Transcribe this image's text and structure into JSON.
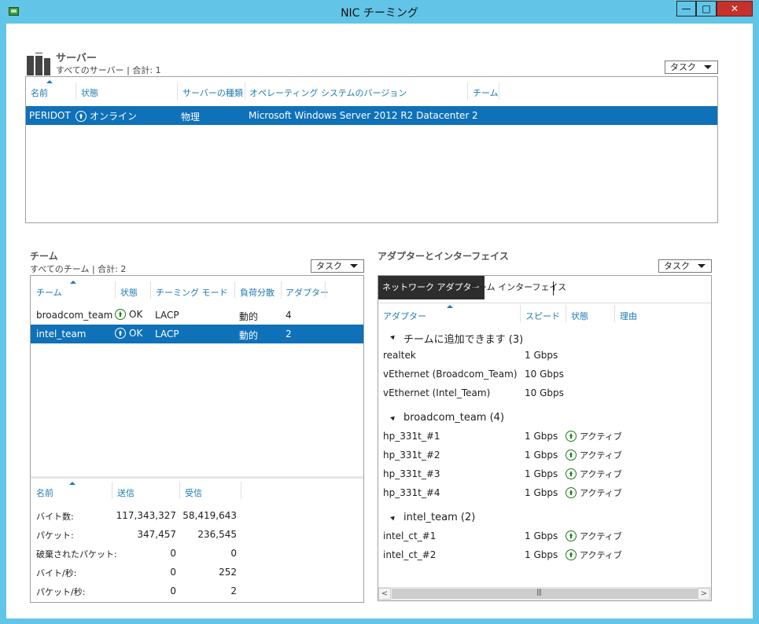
{
  "window": {
    "title": "NIC チーミング",
    "minimize_label": "—",
    "maximize_label": "□",
    "close_label": "✕"
  },
  "servers": {
    "title": "サーバー",
    "subtitle": "すべてのサーバー | 合計: 1",
    "task_label": "タスク",
    "columns": [
      "名前",
      "状態",
      "サーバーの種類",
      "オペレーティング システムのバージョン",
      "チーム"
    ],
    "rows": [
      {
        "name": "PERIDOT",
        "status": "オンライン",
        "type": "物理",
        "os": "Microsoft Windows Server 2012 R2 Datacenter",
        "teams": "2"
      }
    ]
  },
  "teams": {
    "title": "チーム",
    "subtitle": "すべてのチーム | 合計: 2",
    "task_label": "タスク",
    "columns": [
      "チーム",
      "状態",
      "チーミング モード",
      "負荷分散",
      "アダプター"
    ],
    "rows": [
      {
        "team": "broadcom_team",
        "status": "OK",
        "mode": "LACP",
        "lb": "動的",
        "adapters": "4"
      },
      {
        "team": "intel_team",
        "status": "OK",
        "mode": "LACP",
        "lb": "動的",
        "adapters": "2"
      }
    ],
    "stats_columns": [
      "名前",
      "送信",
      "受信"
    ],
    "stats": [
      {
        "name": "バイト数:",
        "sent": "117,343,327",
        "recv": "58,419,643"
      },
      {
        "name": "パケット:",
        "sent": "347,457",
        "recv": "236,545"
      },
      {
        "name": "破棄されたパケット:",
        "sent": "0",
        "recv": "0"
      },
      {
        "name": "バイト/秒:",
        "sent": "0",
        "recv": "252"
      },
      {
        "name": "パケット/秒:",
        "sent": "0",
        "recv": "2"
      }
    ]
  },
  "adapters": {
    "title": "アダプターとインターフェイス",
    "task_label": "タスク",
    "tabs": [
      "ネットワーク アダプター",
      "チーム インターフェイス"
    ],
    "columns": [
      "アダプター",
      "スピード",
      "状態",
      "理由"
    ],
    "groups": [
      {
        "header": "チームに追加できます (3)",
        "items": [
          {
            "name": "realtek",
            "speed": "1 Gbps",
            "status": ""
          },
          {
            "name": "vEthernet (Broadcom_Team)",
            "speed": "10 Gbps",
            "status": ""
          },
          {
            "name": "vEthernet (Intel_Team)",
            "speed": "10 Gbps",
            "status": ""
          }
        ]
      },
      {
        "header": "broadcom_team (4)",
        "items": [
          {
            "name": "hp_331t_#1",
            "speed": "1 Gbps",
            "status": "アクティブ"
          },
          {
            "name": "hp_331t_#2",
            "speed": "1 Gbps",
            "status": "アクティブ"
          },
          {
            "name": "hp_331t_#3",
            "speed": "1 Gbps",
            "status": "アクティブ"
          },
          {
            "name": "hp_331t_#4",
            "speed": "1 Gbps",
            "status": "アクティブ"
          }
        ]
      },
      {
        "header": "intel_team (2)",
        "items": [
          {
            "name": "intel_ct_#1",
            "speed": "1 Gbps",
            "status": "アクティブ"
          },
          {
            "name": "intel_ct_#2",
            "speed": "1 Gbps",
            "status": "アクティブ"
          }
        ]
      }
    ],
    "scroll_left": "<",
    "scroll_right": ">",
    "scroll_grip": "|||"
  }
}
